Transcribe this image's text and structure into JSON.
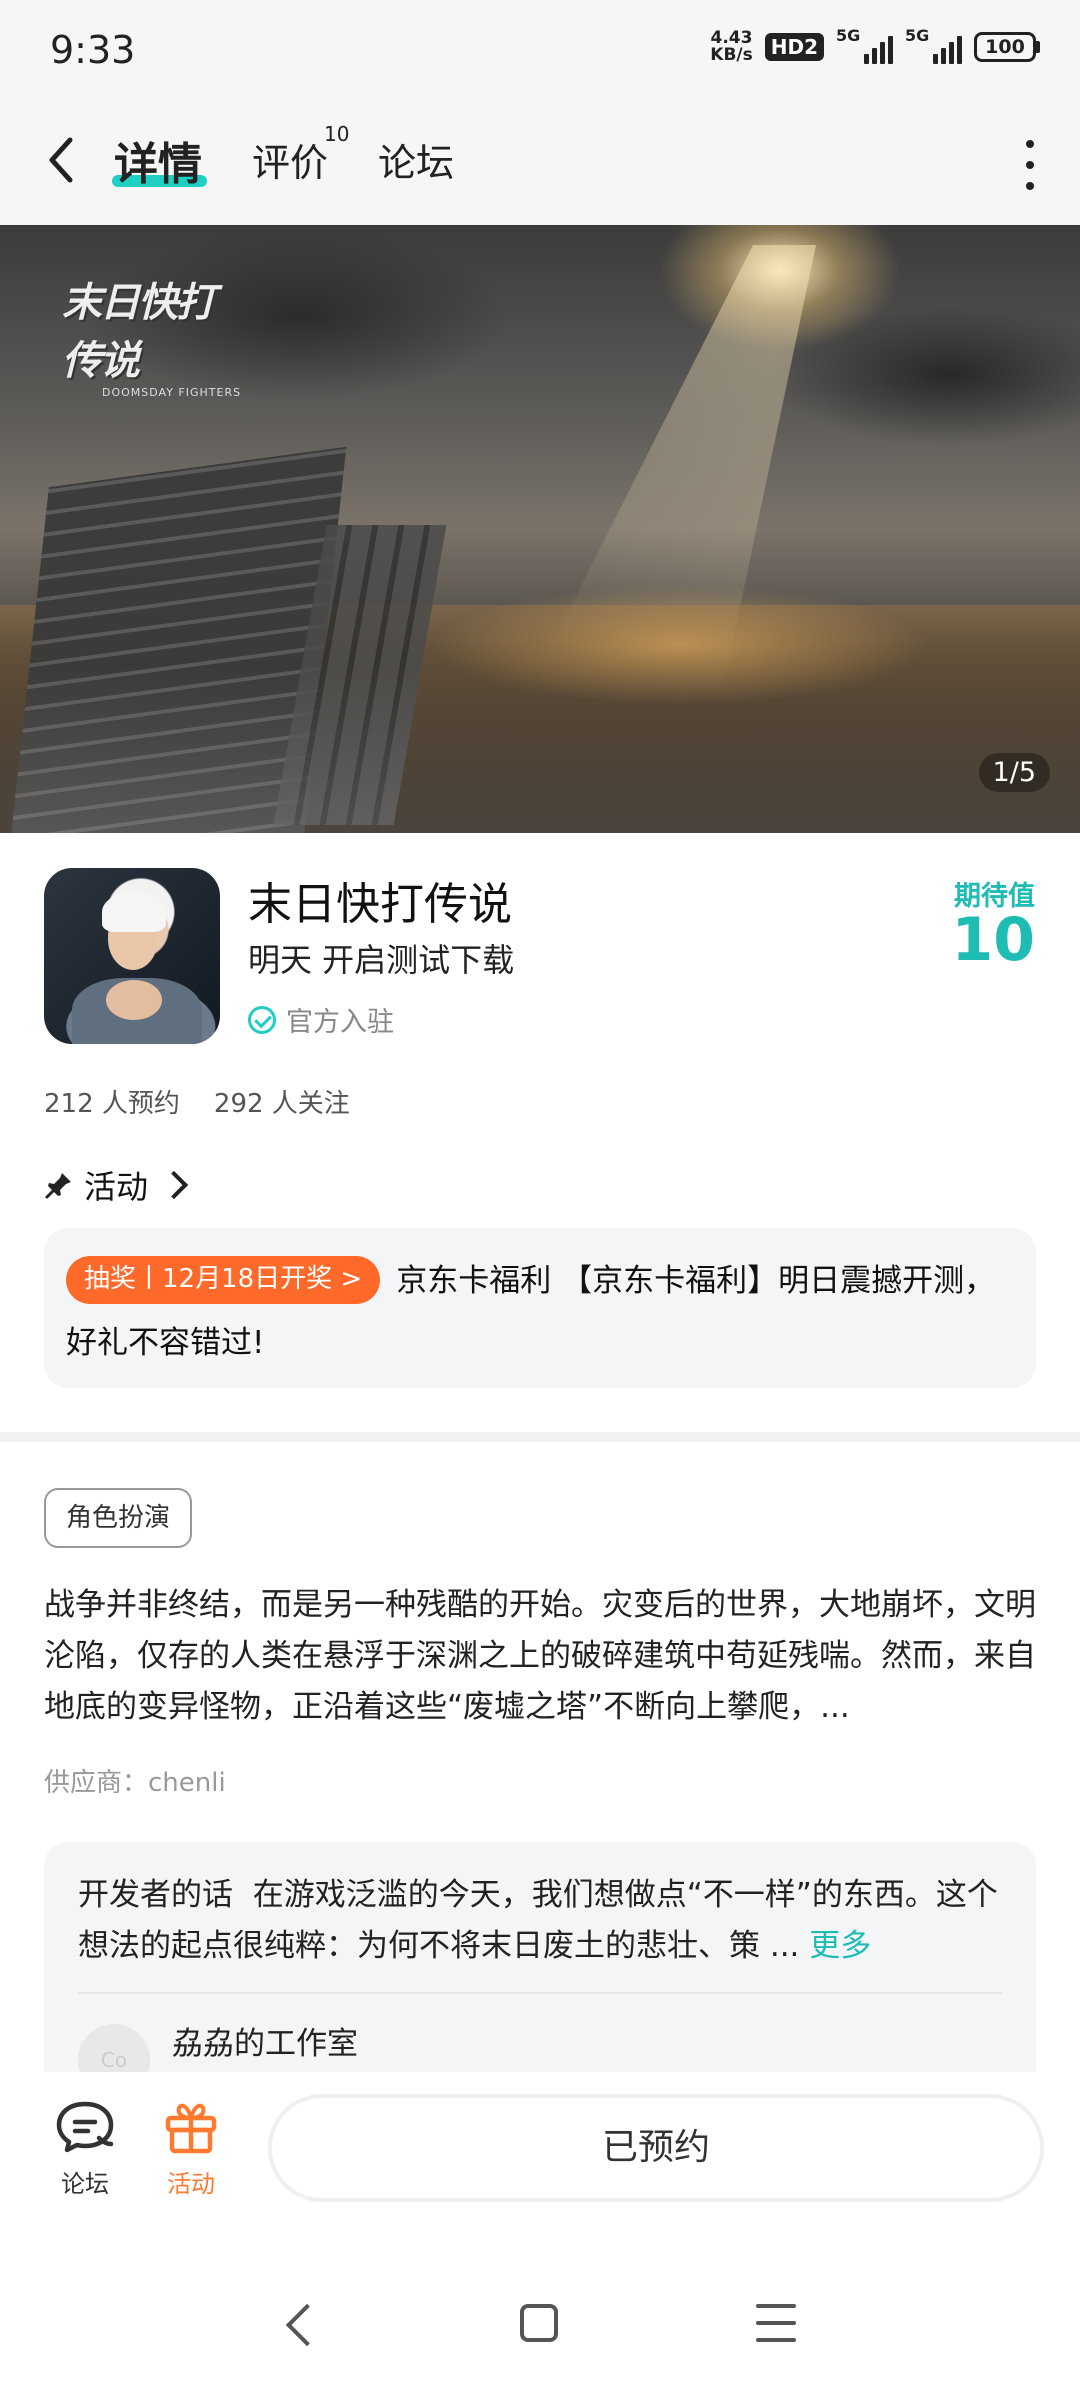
{
  "status_bar": {
    "time": "9:33",
    "speed_value": "4.43",
    "speed_unit": "KB/s",
    "hd": "HD2",
    "sim1": "5G",
    "sim2": "5G",
    "battery": "100"
  },
  "header": {
    "tabs": [
      {
        "label": "详情",
        "active": true
      },
      {
        "label": "评价",
        "badge": "10"
      },
      {
        "label": "论坛"
      }
    ]
  },
  "hero": {
    "logo_text": "末日快打传说",
    "logo_sub": "DOOMSDAY FIGHTERS",
    "counter": "1/5"
  },
  "game": {
    "title": "末日快打传说",
    "subtitle": "明天 开启测试下载",
    "official": "官方入驻",
    "expect_label": "期待值",
    "expect_value": "10",
    "reservations": "212 人预约",
    "followers": "292 人关注"
  },
  "activity": {
    "heading": "活动",
    "tag": "抽奖丨12月18日开奖 >",
    "text": "京东卡福利 【京东卡福利】明日震撼开测，好礼不容错过!"
  },
  "details": {
    "genre": "角色扮演",
    "description": "战争并非终结，而是另一种残酷的开始。灾变后的世界，大地崩坏，文明沦陷，仅存的人类在悬浮于深渊之上的破碎建筑中苟延残喘。然而，来自地底的变异怪物，正沿着这些“废墟之塔”不断向上攀爬，...",
    "supplier": "供应商：chenli"
  },
  "developer": {
    "label": "开发者的话",
    "text": "在游戏泛滥的今天，我们想做点“不一样”的东西。这个想法的起点很纯粹：为何不将末日废土的悲壮、策 ...",
    "more": "更多",
    "avatar_text": "Co",
    "studio": "劦劦的工作室"
  },
  "bottom_bar": {
    "forum_label": "论坛",
    "activity_label": "活动",
    "reserve_label": "已预约"
  },
  "colors": {
    "accent": "#1fcfc4",
    "accent_text": "#1fbcb3",
    "orange": "#ff6a2b"
  }
}
